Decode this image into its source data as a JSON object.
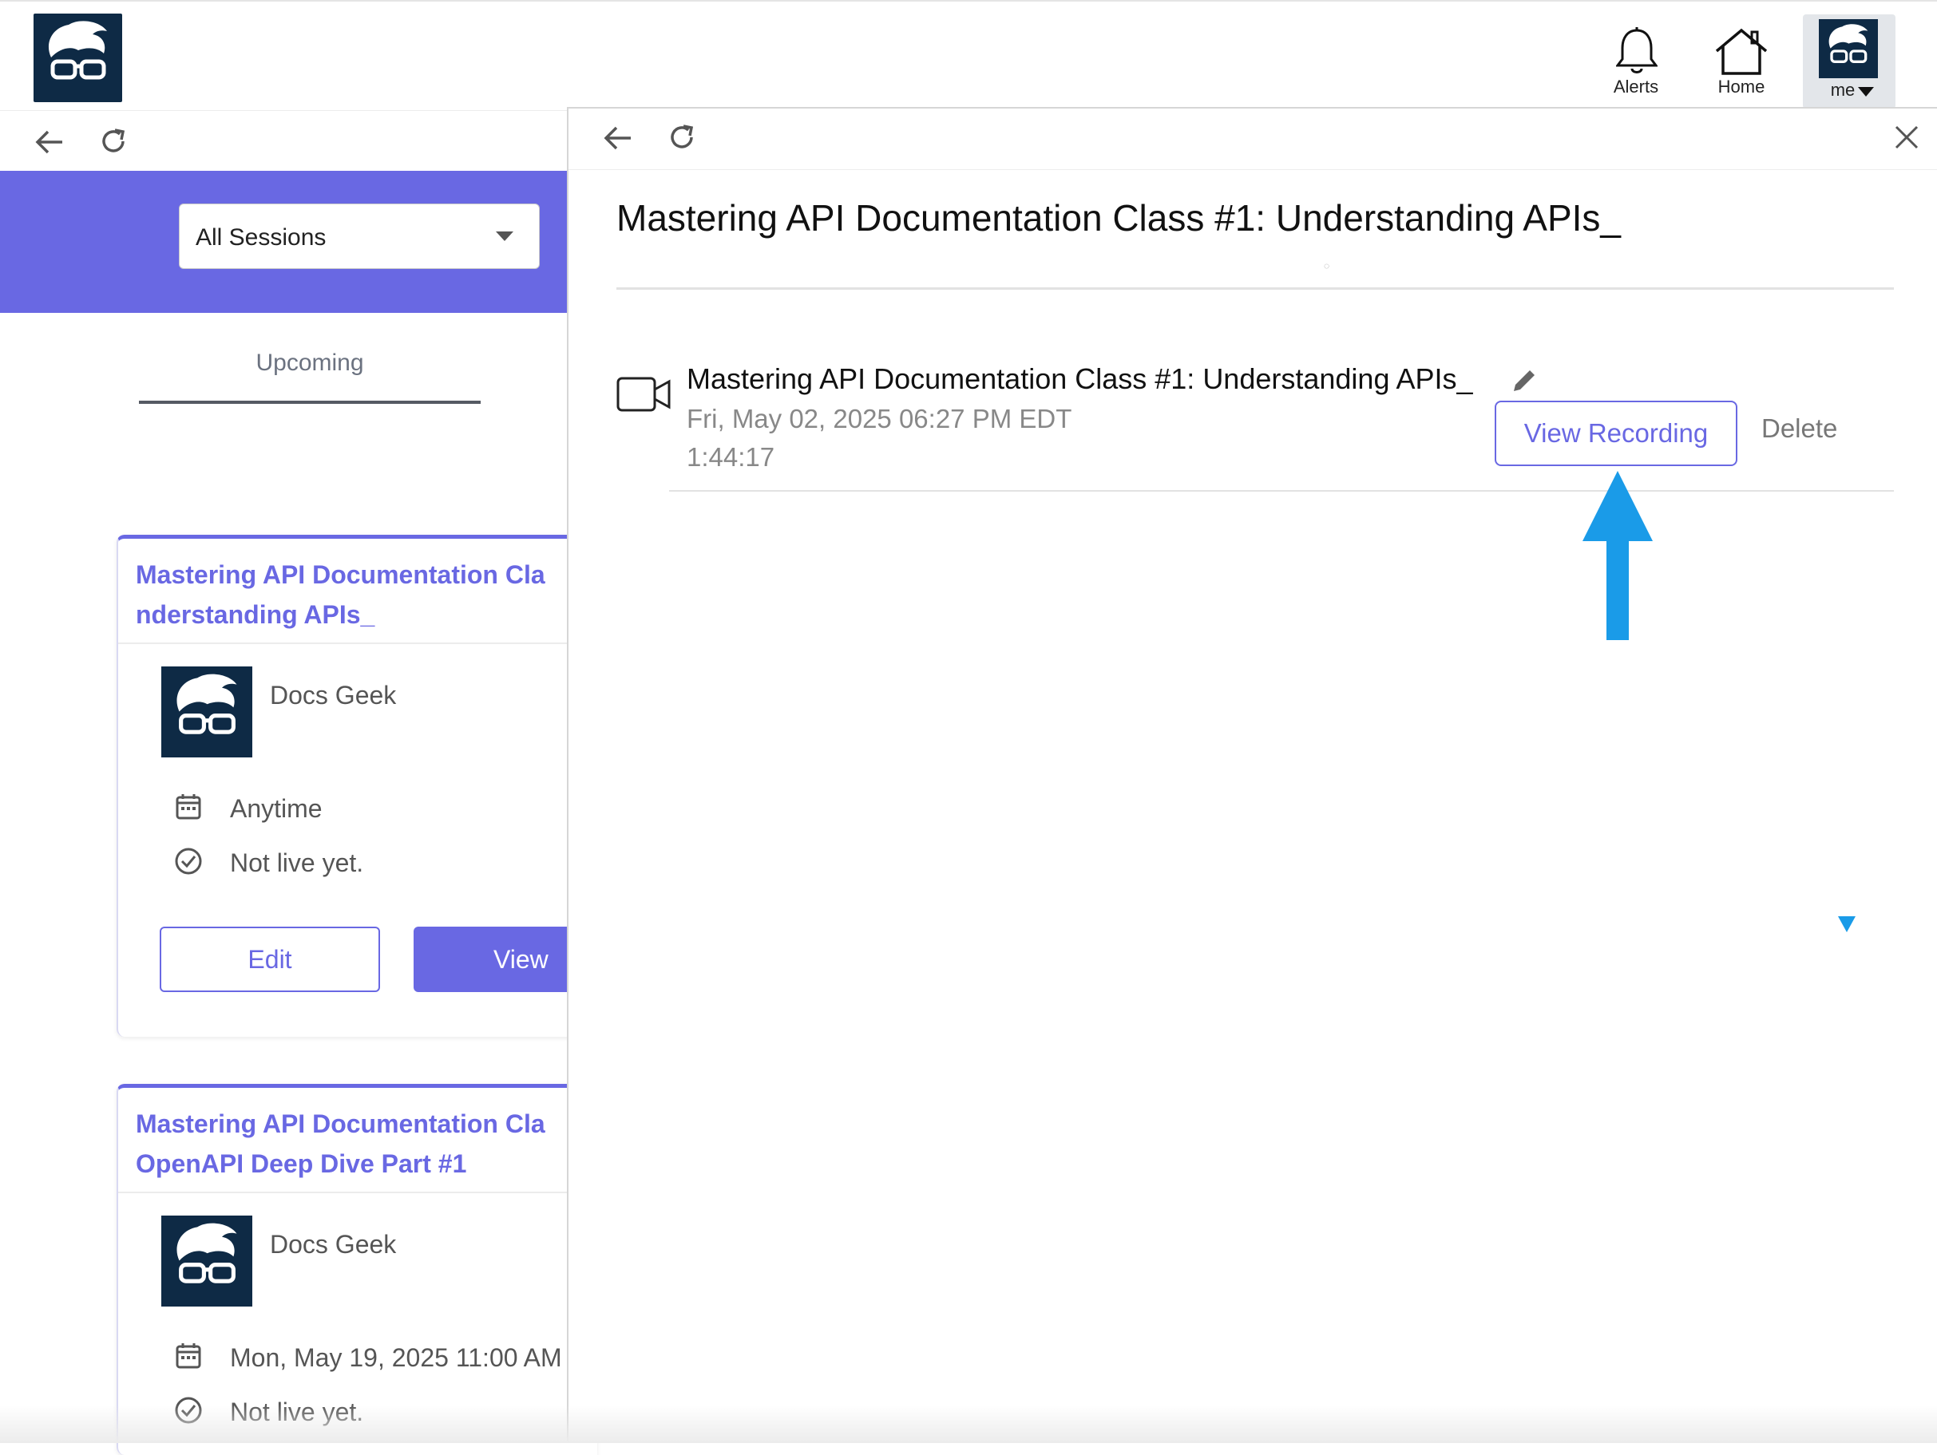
{
  "header": {
    "logo_icon": "docs-geek-logo",
    "alerts_label": "Alerts",
    "home_label": "Home",
    "me_label": "me"
  },
  "left": {
    "filter": {
      "selected": "All Sessions"
    },
    "tab_label": "Upcoming",
    "cards": [
      {
        "title_line1": "Mastering API Documentation Cla",
        "title_line2": "nderstanding APIs_",
        "host": "Docs Geek",
        "when": "Anytime",
        "status": "Not live yet.",
        "edit_label": "Edit",
        "view_label": "View"
      },
      {
        "title_line1": "Mastering API Documentation Cla",
        "title_line2": "OpenAPI Deep Dive Part #1",
        "host": "Docs Geek",
        "when": "Mon, May 19, 2025 11:00 AM",
        "status": "Not live yet."
      }
    ]
  },
  "panel": {
    "title": "Mastering API Documentation Class #1: Understanding APIs_",
    "recording": {
      "title": "Mastering API Documentation Class #1: Understanding APIs_",
      "date": "Fri, May 02, 2025 06:27 PM EDT",
      "duration": "1:44:17",
      "view_label": "View Recording",
      "delete_label": "Delete"
    }
  },
  "colors": {
    "accent": "#6968e3",
    "logo_bg": "#0e2a45",
    "annotation": "#1a9be8"
  }
}
